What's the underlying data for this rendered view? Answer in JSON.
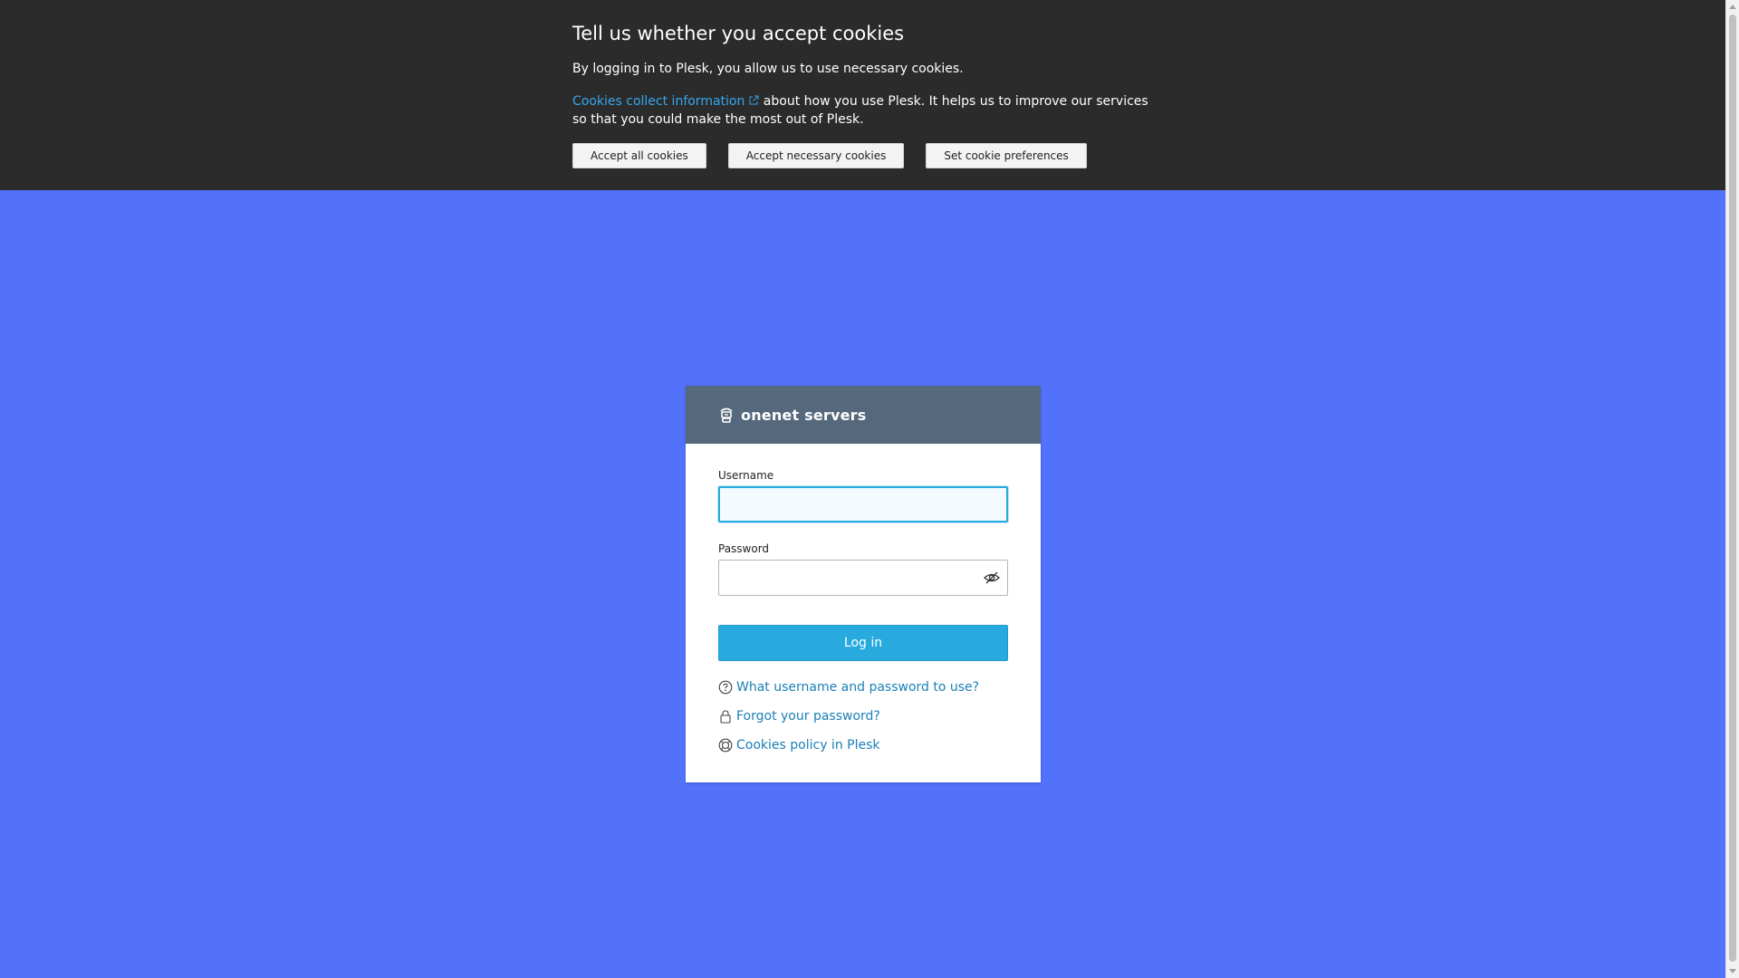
{
  "cookie_banner": {
    "title": "Tell us whether you accept cookies",
    "text1": "By logging in to Plesk, you allow us to use necessary cookies.",
    "link_text": "Cookies collect information",
    "text2_rest": " about how you use Plesk. It helps us to improve our services so that you could make the most out of Plesk.",
    "buttons": {
      "accept_all": "Accept all cookies",
      "accept_necessary": "Accept necessary cookies",
      "preferences": "Set cookie preferences"
    }
  },
  "login": {
    "brand": "onenet servers",
    "username_label": "Username",
    "username_value": "",
    "password_label": "Password",
    "password_value": "",
    "login_button": "Log in",
    "links": {
      "help": "What username and password to use?",
      "forgot": "Forgot your password?",
      "cookies_policy": "Cookies policy in Plesk"
    }
  },
  "colors": {
    "page_background": "#5372fc",
    "banner_background": "#2b2b2b",
    "card_header": "#56687c",
    "primary_button": "#28aade",
    "link": "#1a7fb8",
    "banner_link": "#36a6ee"
  },
  "icons": [
    "external-link-icon",
    "logo-icon",
    "eye-slash-icon",
    "question-circle-icon",
    "lock-icon",
    "globe-icon"
  ]
}
